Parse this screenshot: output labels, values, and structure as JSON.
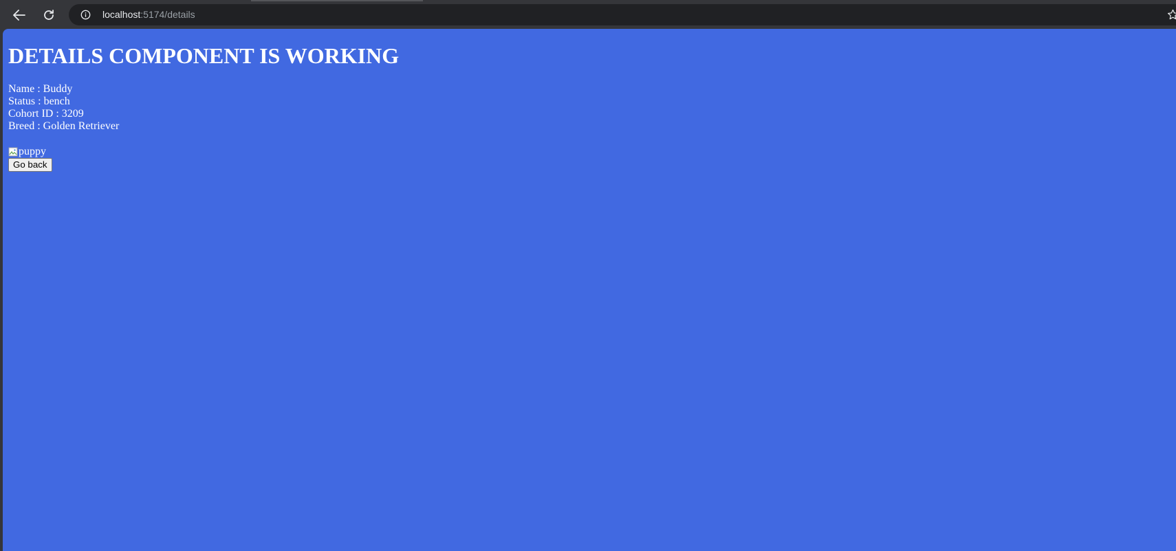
{
  "browser": {
    "url_host": "localhost",
    "url_path": ":5174/details",
    "icons": {
      "back": "back-arrow-icon",
      "reload": "reload-icon",
      "info": "info-icon",
      "bookmark": "star-icon"
    }
  },
  "page": {
    "background_color": "#4169e1",
    "title": "DETAILS COMPONENT IS WORKING",
    "details": [
      "Name : Buddy",
      "Status : bench",
      "Cohort ID : 3209",
      "Breed : Golden Retriever"
    ],
    "image_alt": "puppy",
    "go_back_label": "Go back"
  }
}
